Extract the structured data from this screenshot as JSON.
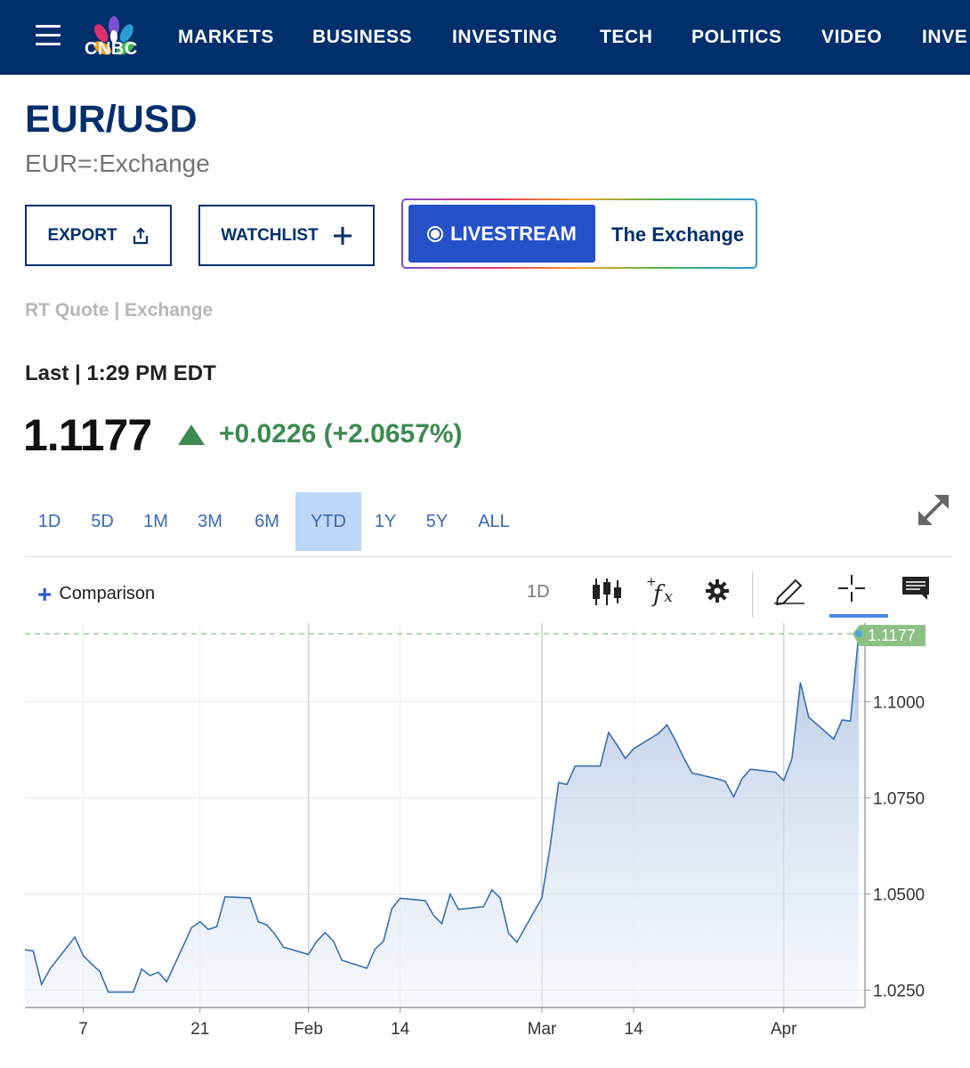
{
  "nav": {
    "logo_text": "CNBC",
    "items": [
      "MARKETS",
      "BUSINESS",
      "INVESTING",
      "TECH",
      "POLITICS",
      "VIDEO",
      "INVE"
    ]
  },
  "quote": {
    "title": "EUR/USD",
    "symbol": "EUR=:Exchange",
    "export_label": "EXPORT",
    "watchlist_label": "WATCHLIST",
    "livestream_label": "LIVESTREAM",
    "livestream_show": "The Exchange",
    "rt_quote": "RT Quote | Exchange",
    "last_label": "Last | 1:29 PM EDT",
    "price": "1.1177",
    "change": "+0.0226 (+2.0657%)",
    "change_color": "#3c8a52"
  },
  "ranges": {
    "items": [
      "1D",
      "5D",
      "1M",
      "3M",
      "6M",
      "YTD",
      "1Y",
      "5Y",
      "ALL"
    ],
    "active": "YTD"
  },
  "toolbar": {
    "comparison_label": "Comparison",
    "interval_label": "1D"
  },
  "chart_data": {
    "type": "area",
    "title": "",
    "xlabel": "",
    "ylabel": "",
    "ylim": [
      1.0205,
      1.1205
    ],
    "y_ticks": [
      1.025,
      1.05,
      1.075,
      1.1
    ],
    "y_tick_labels": [
      "1.0250",
      "1.0500",
      "1.0750",
      "1.1000"
    ],
    "x_ticks": [
      {
        "label": "7",
        "x": "2025-01-07"
      },
      {
        "label": "21",
        "x": "2025-01-21"
      },
      {
        "label": "Feb",
        "x": "2025-02-03"
      },
      {
        "label": "14",
        "x": "2025-02-14"
      },
      {
        "label": "Mar",
        "x": "2025-03-03"
      },
      {
        "label": "14",
        "x": "2025-03-14"
      },
      {
        "label": "Apr",
        "x": "2025-04-01"
      }
    ],
    "last_value_label": "1.1177",
    "last_value": 1.1177,
    "grid": true,
    "line_color": "#3a6fb0",
    "series": [
      {
        "x": [
          "2024-12-31",
          "2025-01-01",
          "2025-01-02",
          "2025-01-03",
          "2025-01-06",
          "2025-01-07",
          "2025-01-08",
          "2025-01-09",
          "2025-01-10",
          "2025-01-13",
          "2025-01-14",
          "2025-01-15",
          "2025-01-16",
          "2025-01-17",
          "2025-01-20",
          "2025-01-21",
          "2025-01-22",
          "2025-01-23",
          "2025-01-24",
          "2025-01-27",
          "2025-01-28",
          "2025-01-29",
          "2025-01-30",
          "2025-01-31",
          "2025-02-03",
          "2025-02-04",
          "2025-02-05",
          "2025-02-06",
          "2025-02-07",
          "2025-02-10",
          "2025-02-11",
          "2025-02-12",
          "2025-02-13",
          "2025-02-14",
          "2025-02-17",
          "2025-02-18",
          "2025-02-19",
          "2025-02-20",
          "2025-02-21",
          "2025-02-24",
          "2025-02-25",
          "2025-02-26",
          "2025-02-27",
          "2025-02-28",
          "2025-03-03",
          "2025-03-04",
          "2025-03-05",
          "2025-03-06",
          "2025-03-07",
          "2025-03-10",
          "2025-03-11",
          "2025-03-12",
          "2025-03-13",
          "2025-03-14",
          "2025-03-17",
          "2025-03-18",
          "2025-03-19",
          "2025-03-20",
          "2025-03-21",
          "2025-03-24",
          "2025-03-25",
          "2025-03-26",
          "2025-03-27",
          "2025-03-28",
          "2025-03-31",
          "2025-04-01",
          "2025-04-02",
          "2025-04-03",
          "2025-04-04",
          "2025-04-07",
          "2025-04-08",
          "2025-04-09",
          "2025-04-10",
          "2025-04-11"
        ],
        "values": [
          1.0355,
          1.0352,
          1.0265,
          1.0305,
          1.0388,
          1.034,
          1.0318,
          1.0298,
          1.0245,
          1.0245,
          1.0305,
          1.0288,
          1.0297,
          1.0272,
          1.0413,
          1.0428,
          1.0408,
          1.0415,
          1.0493,
          1.049,
          1.0428,
          1.042,
          1.0395,
          1.0362,
          1.0343,
          1.0377,
          1.04,
          1.0378,
          1.0328,
          1.0307,
          1.0357,
          1.0377,
          1.0462,
          1.0489,
          1.0483,
          1.0445,
          1.0423,
          1.05,
          1.046,
          1.0467,
          1.0511,
          1.049,
          1.0398,
          1.0375,
          1.049,
          1.0625,
          1.079,
          1.0785,
          1.0833,
          1.0833,
          1.092,
          1.0888,
          1.0853,
          1.0878,
          1.0918,
          1.094,
          1.09,
          1.0855,
          1.0815,
          1.08,
          1.0793,
          1.0753,
          1.08,
          1.0825,
          1.0817,
          1.0795,
          1.0853,
          1.105,
          1.096,
          1.0903,
          1.0953,
          1.095,
          1.1177,
          1.1177
        ]
      }
    ]
  }
}
